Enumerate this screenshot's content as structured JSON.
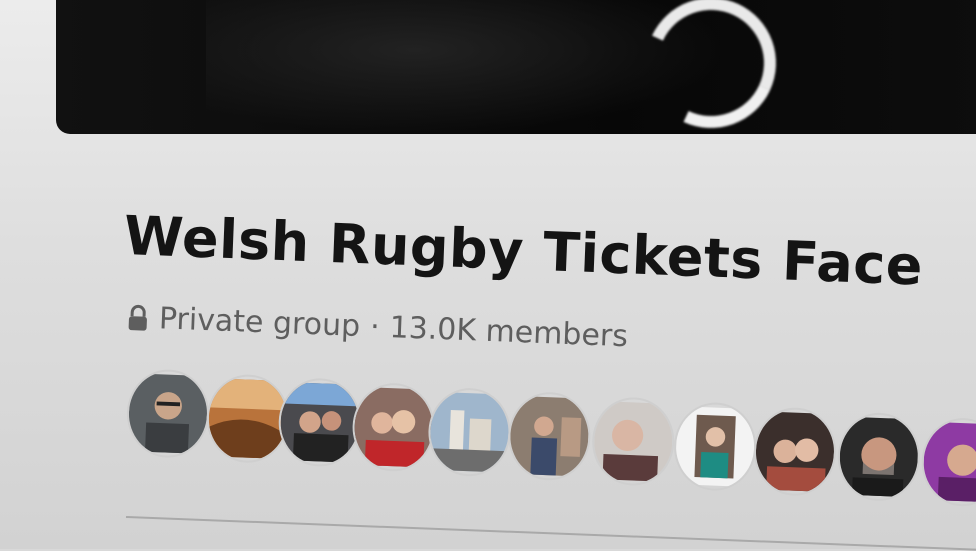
{
  "group": {
    "name": "Welsh Rugby Tickets Face",
    "privacy": "Private group",
    "separator": "·",
    "members": "13.0K members"
  },
  "icons": {
    "privacy": "lock-icon"
  },
  "colors": {
    "title": "#141414",
    "meta": "#5e5e5e",
    "cover": "#0a0a0a",
    "background": "#e2e2e2"
  },
  "members_preview": [
    {
      "name": "member-avatar-1"
    },
    {
      "name": "member-avatar-2"
    },
    {
      "name": "member-avatar-3"
    },
    {
      "name": "member-avatar-4"
    },
    {
      "name": "member-avatar-5"
    },
    {
      "name": "member-avatar-6"
    },
    {
      "name": "member-avatar-7"
    },
    {
      "name": "member-avatar-8"
    },
    {
      "name": "member-avatar-9"
    },
    {
      "name": "member-avatar-10"
    },
    {
      "name": "member-avatar-11"
    }
  ]
}
